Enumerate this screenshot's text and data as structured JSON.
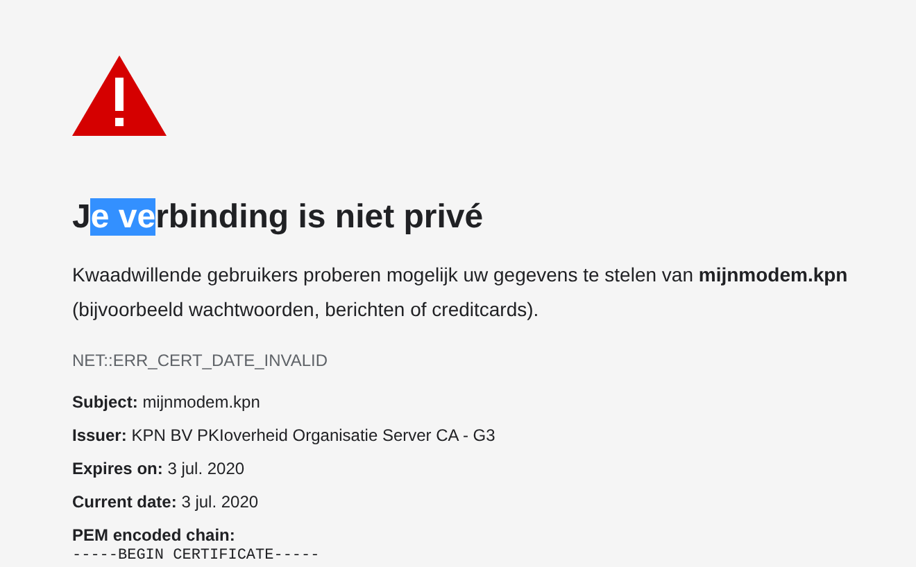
{
  "heading": {
    "before": "J",
    "selected_text": "e ve",
    "after": "rbinding is niet privé"
  },
  "message": "Kwaadwillende gebruikers proberen mogelijk uw gegevens te stelen van **mijnmodem.kpn** (bijvoorbeeld wachtwoorden, berichten of creditcards).",
  "error_code": "NET::ERR_CERT_DATE_INVALID",
  "details": [
    {
      "label": "Subject:",
      "value": "mijnmodem.kpn"
    },
    {
      "label": "Issuer:",
      "value": "KPN BV PKIoverheid Organisatie Server CA - G3"
    },
    {
      "label": "Expires on:",
      "value": "3 jul. 2020"
    },
    {
      "label": "Current date:",
      "value": "3 jul. 2020"
    }
  ],
  "pem": {
    "label": "PEM encoded chain:",
    "first_line": "-----BEGIN CERTIFICATE-----"
  }
}
